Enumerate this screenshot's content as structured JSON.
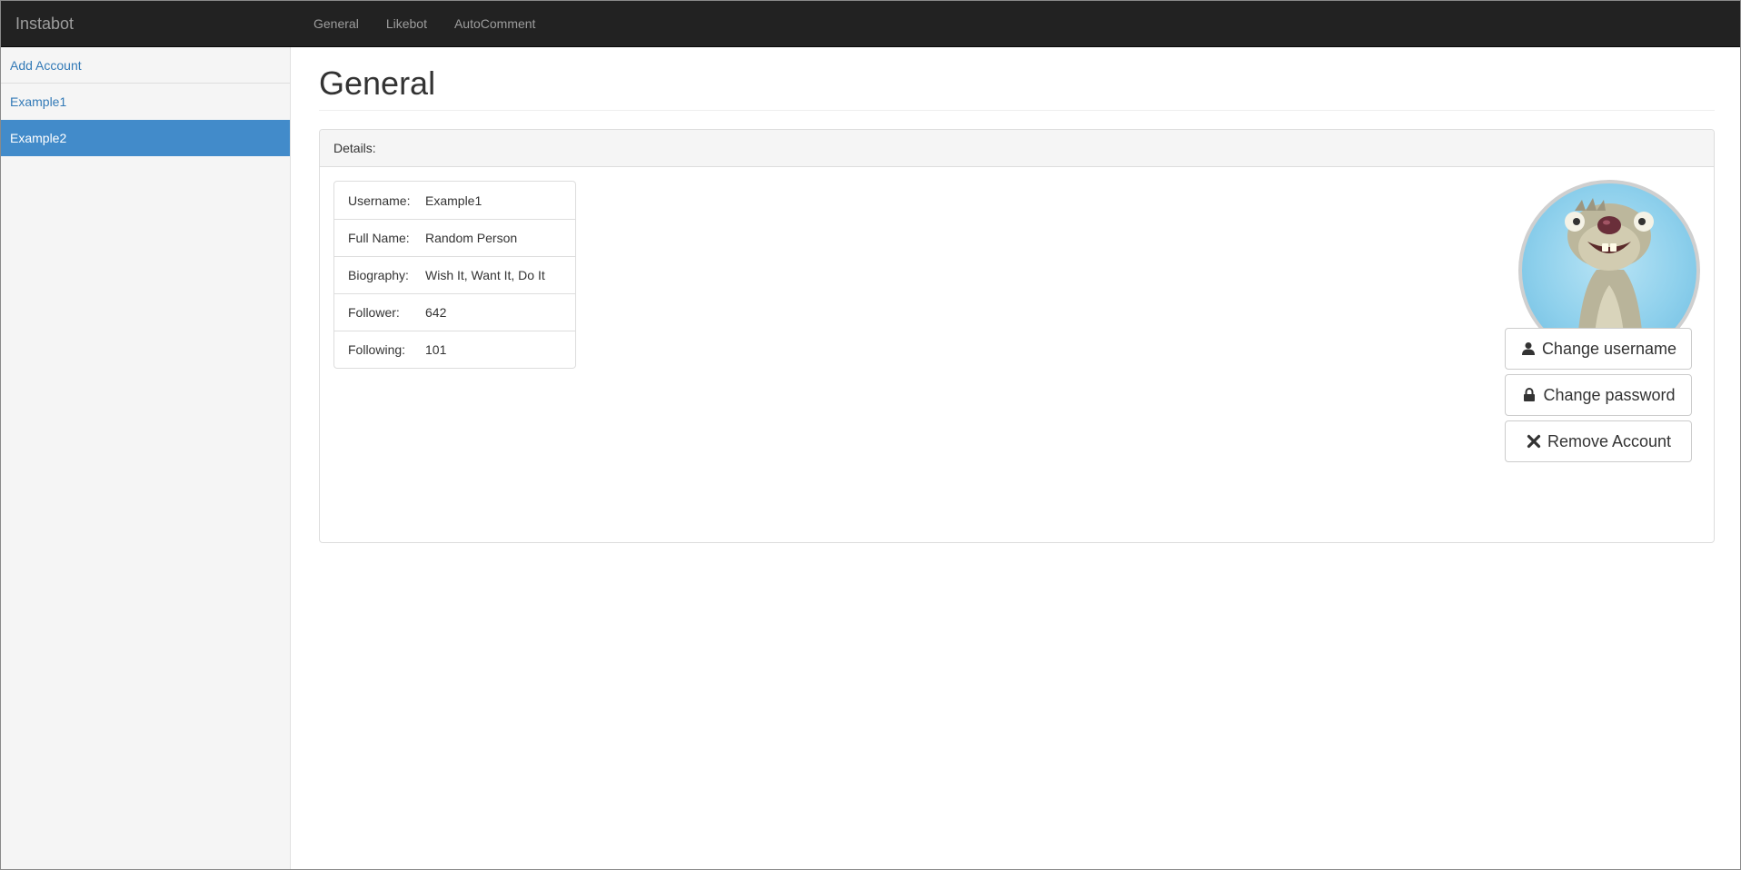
{
  "navbar": {
    "brand": "Instabot",
    "links": [
      "General",
      "Likebot",
      "AutoComment"
    ]
  },
  "sidebar": {
    "add_account": "Add Account",
    "accounts": [
      "Example1",
      "Example2"
    ],
    "active_account": "Example2"
  },
  "main": {
    "title": "General",
    "panel_heading": "Details:",
    "details": [
      {
        "label": "Username:",
        "value": "Example1"
      },
      {
        "label": "Full Name:",
        "value": "Random Person"
      },
      {
        "label": "Biography:",
        "value": "Wish It, Want It, Do It"
      },
      {
        "label": "Follower:",
        "value": "642"
      },
      {
        "label": "Following:",
        "value": "101"
      }
    ],
    "buttons": {
      "change_username": "Change username",
      "change_password": "Change password",
      "remove_account": "Remove Account"
    }
  },
  "icons": {
    "change_username": "user-icon",
    "change_password": "lock-icon",
    "remove_account": "remove-icon"
  },
  "colors": {
    "navbar_bg": "#222222",
    "navbar_text": "#9d9d9d",
    "sidebar_bg": "#f5f5f5",
    "link": "#337ab7",
    "active_bg": "#428bca"
  }
}
